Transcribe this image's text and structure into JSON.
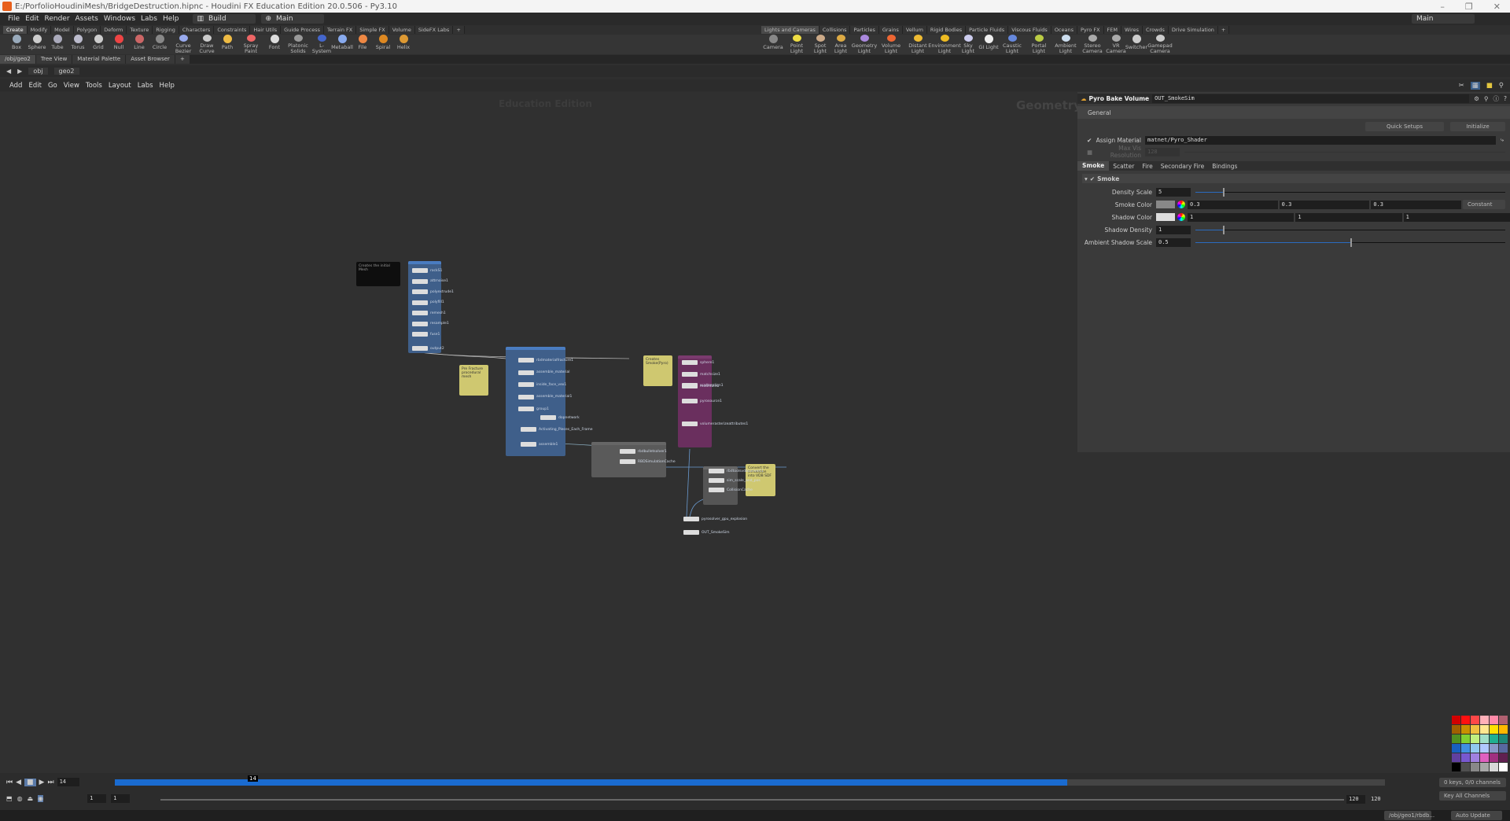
{
  "window": {
    "title": "E:/PorfolioHoudiniMesh/BridgeDestruction.hipnc - Houdini FX Education Edition 20.0.506 - Py3.10",
    "min": "–",
    "max": "❐",
    "close": "✕"
  },
  "menu": [
    "File",
    "Edit",
    "Render",
    "Assets",
    "Windows",
    "Labs",
    "Help"
  ],
  "desktop": "Build",
  "workspace": "Main",
  "right_workspace": "Main",
  "shelf_left_tabs": [
    "Create",
    "Modify",
    "Model",
    "Polygon",
    "Deform",
    "Texture",
    "Rigging",
    "Characters",
    "Constraints",
    "Hair Utils",
    "Guide Process",
    "Terrain FX",
    "Simple FX",
    "Volume",
    "SideFX Labs",
    "+"
  ],
  "shelf_left_tools": [
    "Box",
    "Sphere",
    "Tube",
    "Torus",
    "Grid",
    "Null",
    "Line",
    "Circle",
    "Curve Bezier",
    "Draw Curve",
    "Path",
    "Spray Paint",
    "Font",
    "Platonic Solids",
    "L-System",
    "Metaball",
    "File",
    "Spiral",
    "Helix"
  ],
  "shelf_right_tabs": [
    "Lights and Cameras",
    "Collisions",
    "Particles",
    "Grains",
    "Vellum",
    "Rigid Bodies",
    "Particle Fluids",
    "Viscous Fluids",
    "Oceans",
    "Pyro FX",
    "FEM",
    "Wires",
    "Crowds",
    "Drive Simulation",
    "+"
  ],
  "shelf_right_tools": [
    "Camera",
    "Point Light",
    "Spot Light",
    "Area Light",
    "Geometry Light",
    "Volume Light",
    "Distant Light",
    "Environment Light",
    "Sky Light",
    "GI Light",
    "Caustic Light",
    "Portal Light",
    "Ambient Light",
    "Stereo Camera",
    "VR Camera",
    "Switcher",
    "Gamepad Camera"
  ],
  "pane_tabs": [
    "/obj/geo2",
    "Tree View",
    "Material Palette",
    "Asset Browser",
    "+"
  ],
  "path": [
    "obj",
    "geo2"
  ],
  "network_menu": [
    "Add",
    "Edit",
    "Go",
    "View",
    "Tools",
    "Layout",
    "Labs",
    "Help"
  ],
  "network": {
    "watermark": "Education Edition",
    "context": "Geometry",
    "notes": [
      "Creates the initial Mesh",
      "Pre Fracture procedural mesh",
      "Creates Smoke(Pyro)",
      "Convert the simulation into VDB SDF"
    ],
    "group1": [
      "rockS1",
      "attrnoise1",
      "polyextrude1",
      "polyfill1",
      "remesh1",
      "resample1",
      "fuse1",
      "output2"
    ],
    "group2": [
      "rbdmaterialfracture1",
      "assemble_material",
      "inside_face_vex1",
      "assemble_material1",
      "group1",
      "dopnetwork",
      "Activating_Pieces_Each_Frame",
      "assemble1"
    ],
    "pyro_group": [
      "sphere1",
      "matchsize1",
      "mountain1",
      "scatteralign1",
      "pyrosource1",
      "volumerasterizeattributes1"
    ],
    "sim_group": [
      "rbdbulletsolver1",
      "RBDSimulationCache"
    ],
    "cache_group": [
      "rbdtoolsvdbconvert1",
      "sim_scale_and_pos",
      "CollisionCache"
    ],
    "out_nodes": [
      "pyrosolver_gpu_explosion",
      "OUT_SmokeSim"
    ]
  },
  "params": {
    "node_type": "Pyro Bake Volume",
    "node_name": "OUT_SmokeSim",
    "tab": "General",
    "quick_setups": "Quick Setups",
    "initialize": "Initialize",
    "assign_material_label": "Assign Material",
    "assign_material": "matnet/Pyro_Shader",
    "assign_material_checked": true,
    "max_vis_label": "Max Vis Resolution",
    "max_vis": "128",
    "subtabs": [
      "Smoke",
      "Scatter",
      "Fire",
      "Secondary Fire",
      "Bindings"
    ],
    "section": "Smoke",
    "density_scale_label": "Density Scale",
    "density_scale": "5",
    "smoke_color_label": "Smoke Color",
    "smoke_color": [
      "0.3",
      "0.3",
      "0.3"
    ],
    "smoke_mode": "Constant",
    "shadow_color_label": "Shadow Color",
    "shadow_color": [
      "1",
      "1",
      "1"
    ],
    "shadow_density_label": "Shadow Density",
    "shadow_density": "1",
    "ambient_label": "Ambient Shadow Scale",
    "ambient": "0.5"
  },
  "timeline": {
    "frame": "14",
    "current_marker": "14",
    "start": "1",
    "start2": "1",
    "end": "120",
    "end2": "120",
    "keys": "0 keys, 0/0 channels",
    "key_all": "Key All Channels",
    "played_fraction": 0.75
  },
  "status": {
    "path": "/obj/geo1/rbdb...",
    "auto_update": "Auto Update"
  },
  "palette": [
    "#d10000",
    "#ff1010",
    "#ff4848",
    "#ffb0b8",
    "#ff8aa8",
    "#b06070",
    "#a06000",
    "#c89000",
    "#f0c040",
    "#ffe890",
    "#ffe000",
    "#ffb800",
    "#509020",
    "#80d030",
    "#c0f080",
    "#a0e0c8",
    "#20b090",
    "#208878",
    "#1860c0",
    "#4090e0",
    "#90c8f0",
    "#b0c8ff",
    "#8898c8",
    "#5868a0",
    "#6040a0",
    "#7858d0",
    "#a080e0",
    "#e060c0",
    "#a03080",
    "#602050",
    "#000000",
    "#505050",
    "#888888",
    "#a8a8a8",
    "#d8d8d8",
    "#ffffff"
  ]
}
